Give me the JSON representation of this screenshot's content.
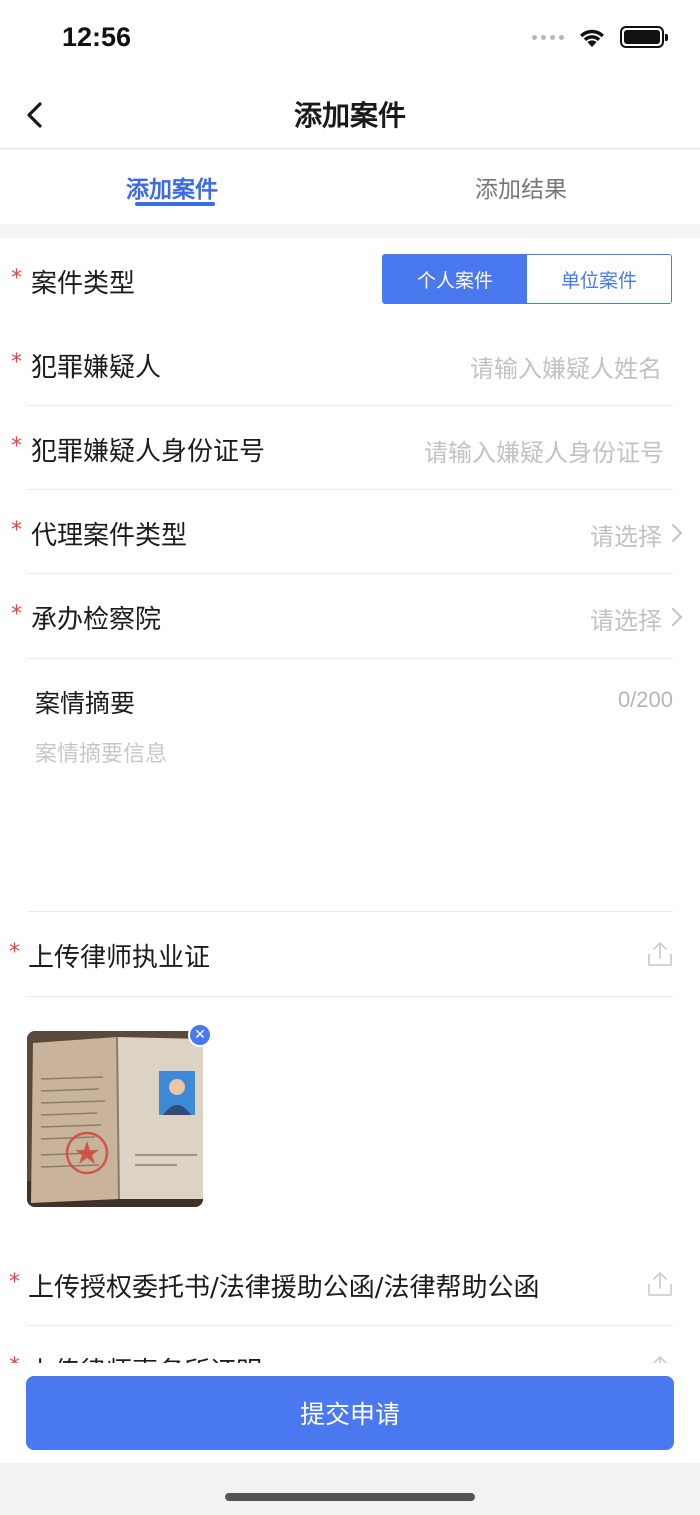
{
  "status_bar": {
    "time": "12:56"
  },
  "nav": {
    "title": "添加案件"
  },
  "tabs": [
    {
      "label": "添加案件",
      "active": true
    },
    {
      "label": "添加结果",
      "active": false
    }
  ],
  "form": {
    "case_type": {
      "required_mark": "*",
      "label": "案件类型",
      "options": [
        "个人案件",
        "单位案件"
      ],
      "selected": "个人案件"
    },
    "suspect_name": {
      "required_mark": "*",
      "label": "犯罪嫌疑人",
      "placeholder": "请输入嫌疑人姓名"
    },
    "suspect_id": {
      "required_mark": "*",
      "label": "犯罪嫌疑人身份证号",
      "placeholder": "请输入嫌疑人身份证号"
    },
    "agency_case_type": {
      "required_mark": "*",
      "label": "代理案件类型",
      "placeholder": "请选择"
    },
    "procuratorate": {
      "required_mark": "*",
      "label": "承办检察院",
      "placeholder": "请选择"
    },
    "summary": {
      "label": "案情摘要",
      "count": "0/200",
      "placeholder": "案情摘要信息"
    },
    "upload_license": {
      "required_mark": "*",
      "label": "上传律师执业证"
    },
    "upload_authorization": {
      "required_mark": "*",
      "label": "上传授权委托书/法律援助公函/法律帮助公函"
    },
    "upload_firm_proof": {
      "required_mark": "*",
      "label": "上传律师事务所证明"
    }
  },
  "submit": {
    "label": "提交申请"
  },
  "colors": {
    "accent": "#4a78ef",
    "required": "#e64545",
    "tab_active": "#3b6ce6"
  }
}
